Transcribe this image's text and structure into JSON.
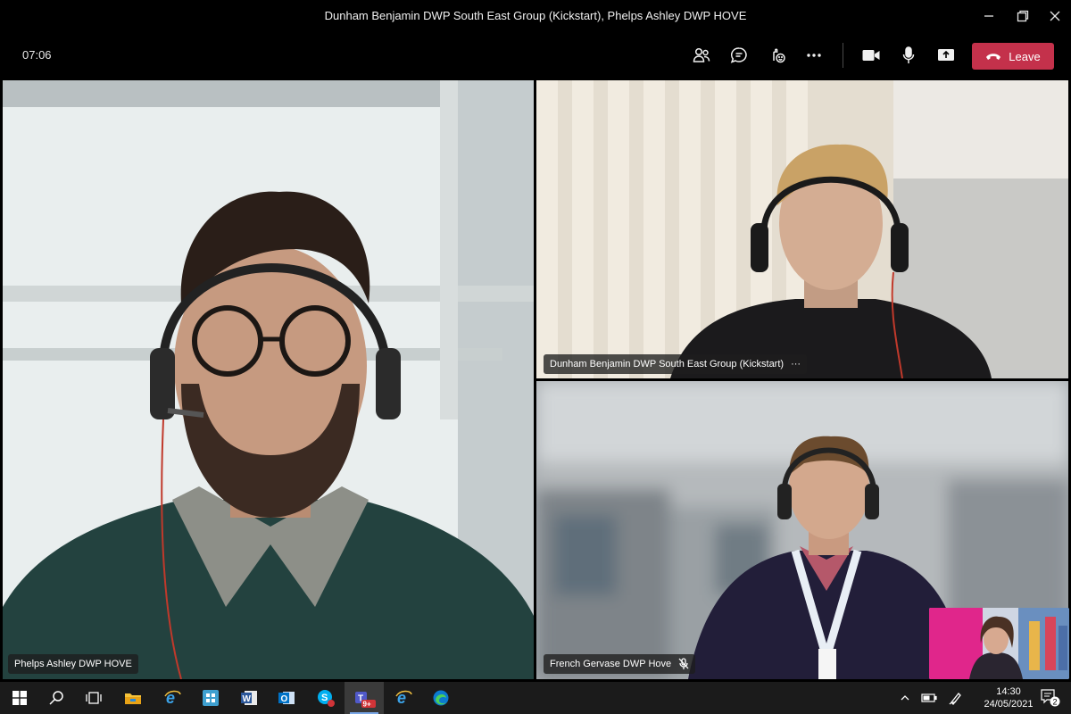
{
  "window": {
    "title": "Dunham Benjamin DWP South East Group (Kickstart), Phelps Ashley DWP HOVE"
  },
  "meeting_bar": {
    "timer": "07:06",
    "leave_label": "Leave",
    "leave_color": "#c4314b",
    "icons": [
      "participants-icon",
      "chat-icon",
      "reactions-icon",
      "more-actions-icon",
      "camera-icon",
      "microphone-icon",
      "share-screen-icon"
    ]
  },
  "participants": [
    {
      "name": "Phelps Ashley DWP HOVE",
      "muted": false,
      "has_more": false
    },
    {
      "name": "Dunham Benjamin DWP South East Group (Kickstart)",
      "muted": false,
      "has_more": true,
      "more_label": "···"
    },
    {
      "name": "French Gervase DWP Hove",
      "muted": true,
      "has_more": false
    }
  ],
  "taskbar": {
    "apps": [
      "start-icon",
      "search-icon",
      "task-view-icon",
      "file-explorer-icon",
      "internet-explorer-icon",
      "software-center-icon",
      "word-icon",
      "outlook-icon",
      "skype-icon",
      "teams-icon",
      "internet-explorer-icon",
      "edge-icon"
    ],
    "teams_badge": "9+",
    "time": "14:30",
    "date": "24/05/2021",
    "notifications_count": "2"
  }
}
